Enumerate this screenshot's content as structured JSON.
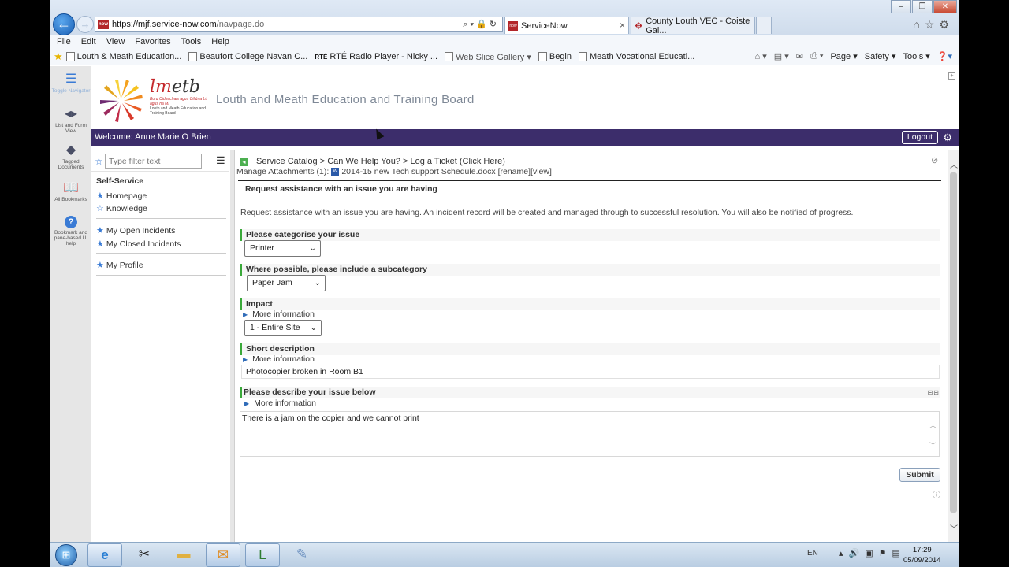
{
  "browser": {
    "url_main": "https://mjf.service-now.com",
    "url_rest": "/navpage.do",
    "tabs": [
      {
        "label": "ServiceNow",
        "active": true
      },
      {
        "label": "County Louth VEC - Coiste Gai...",
        "active": false
      }
    ],
    "menu": [
      "File",
      "Edit",
      "View",
      "Favorites",
      "Tools",
      "Help"
    ],
    "favorites": [
      "Louth & Meath Education...",
      "Beaufort College Navan C...",
      "RTÉ Radio Player - Nicky ...",
      "Web Slice Gallery ▾",
      "Begin",
      "Meath Vocational Educati..."
    ],
    "rte_tag": "RTÉ",
    "commands": [
      "Page ▾",
      "Safety ▾",
      "Tools ▾"
    ]
  },
  "rail": [
    {
      "icon": "list-icon",
      "label": "Toggle Navigator"
    },
    {
      "icon": "list-form-icon",
      "label": "List and Form View"
    },
    {
      "icon": "tag-icon",
      "label": "Tagged Documents"
    },
    {
      "icon": "book-icon",
      "label": "All Bookmarks"
    },
    {
      "icon": "help-icon",
      "label": "Bookmark and pane-based UI help"
    }
  ],
  "header": {
    "brand_a": "lm",
    "brand_b": "etb",
    "brand_sub_irish": "Bord Oideachais agus Oiliúna Lú agus na Mí",
    "brand_sub_en": "Louth and Meath Education and Training Board",
    "title": "Louth and Meath Education and Training Board",
    "welcome": "Welcome: Anne Marie O Brien",
    "logout": "Logout"
  },
  "nav": {
    "filter_placeholder": "Type filter text",
    "section": "Self-Service",
    "items": [
      "Homepage",
      "Knowledge",
      "My Open Incidents",
      "My Closed Incidents",
      "My Profile"
    ]
  },
  "content": {
    "breadcrumb": [
      "Service Catalog",
      "Can We Help You?",
      "Log a Ticket (Click Here)"
    ],
    "attachments_label": "Manage Attachments (1):",
    "attachment_file": "2014-15 new Tech support Schedule.docx",
    "attachment_actions": "[rename][view]",
    "heading": "Request assistance with an issue you are having",
    "description": "Request assistance with an issue you are having.  An incident record will be created and managed through to successful resolution.  You will also be notified of progress.",
    "more_info": "More information",
    "q_category": "Please categorise your issue",
    "category_value": "Printer",
    "q_subcategory": "Where possible, please include a subcategory",
    "subcategory_value": "Paper Jam",
    "q_impact": "Impact",
    "impact_value": "1 - Entire Site",
    "q_short": "Short description",
    "short_value": "Photocopier broken in Room B1",
    "q_describe": "Please describe your issue below",
    "describe_value": "There is a jam on the copier and we cannot print",
    "submit": "Submit"
  },
  "taskbar": {
    "lang": "EN",
    "time": "17:29",
    "date": "05/09/2014"
  }
}
